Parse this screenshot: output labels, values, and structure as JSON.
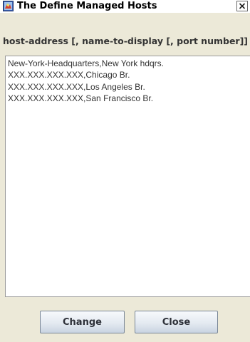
{
  "window": {
    "title": "The Define Managed Hosts",
    "app_icon": "java-app-icon",
    "close_icon": "close-x-icon"
  },
  "header": {
    "label": "host-address [, name-to-display [, port number]]"
  },
  "hosts": {
    "value": "New-York-Headquarters,New York hdqrs.\nXXX.XXX.XXX.XXX,Chicago Br.\nXXX.XXX.XXX.XXX,Los Angeles Br.\nXXX.XXX.XXX.XXX,San Francisco Br."
  },
  "buttons": {
    "change_label": "Change",
    "close_label": "Close"
  },
  "colors": {
    "window_bg": "#ece9d8",
    "text": "#333333",
    "button_border": "#7a8797"
  }
}
